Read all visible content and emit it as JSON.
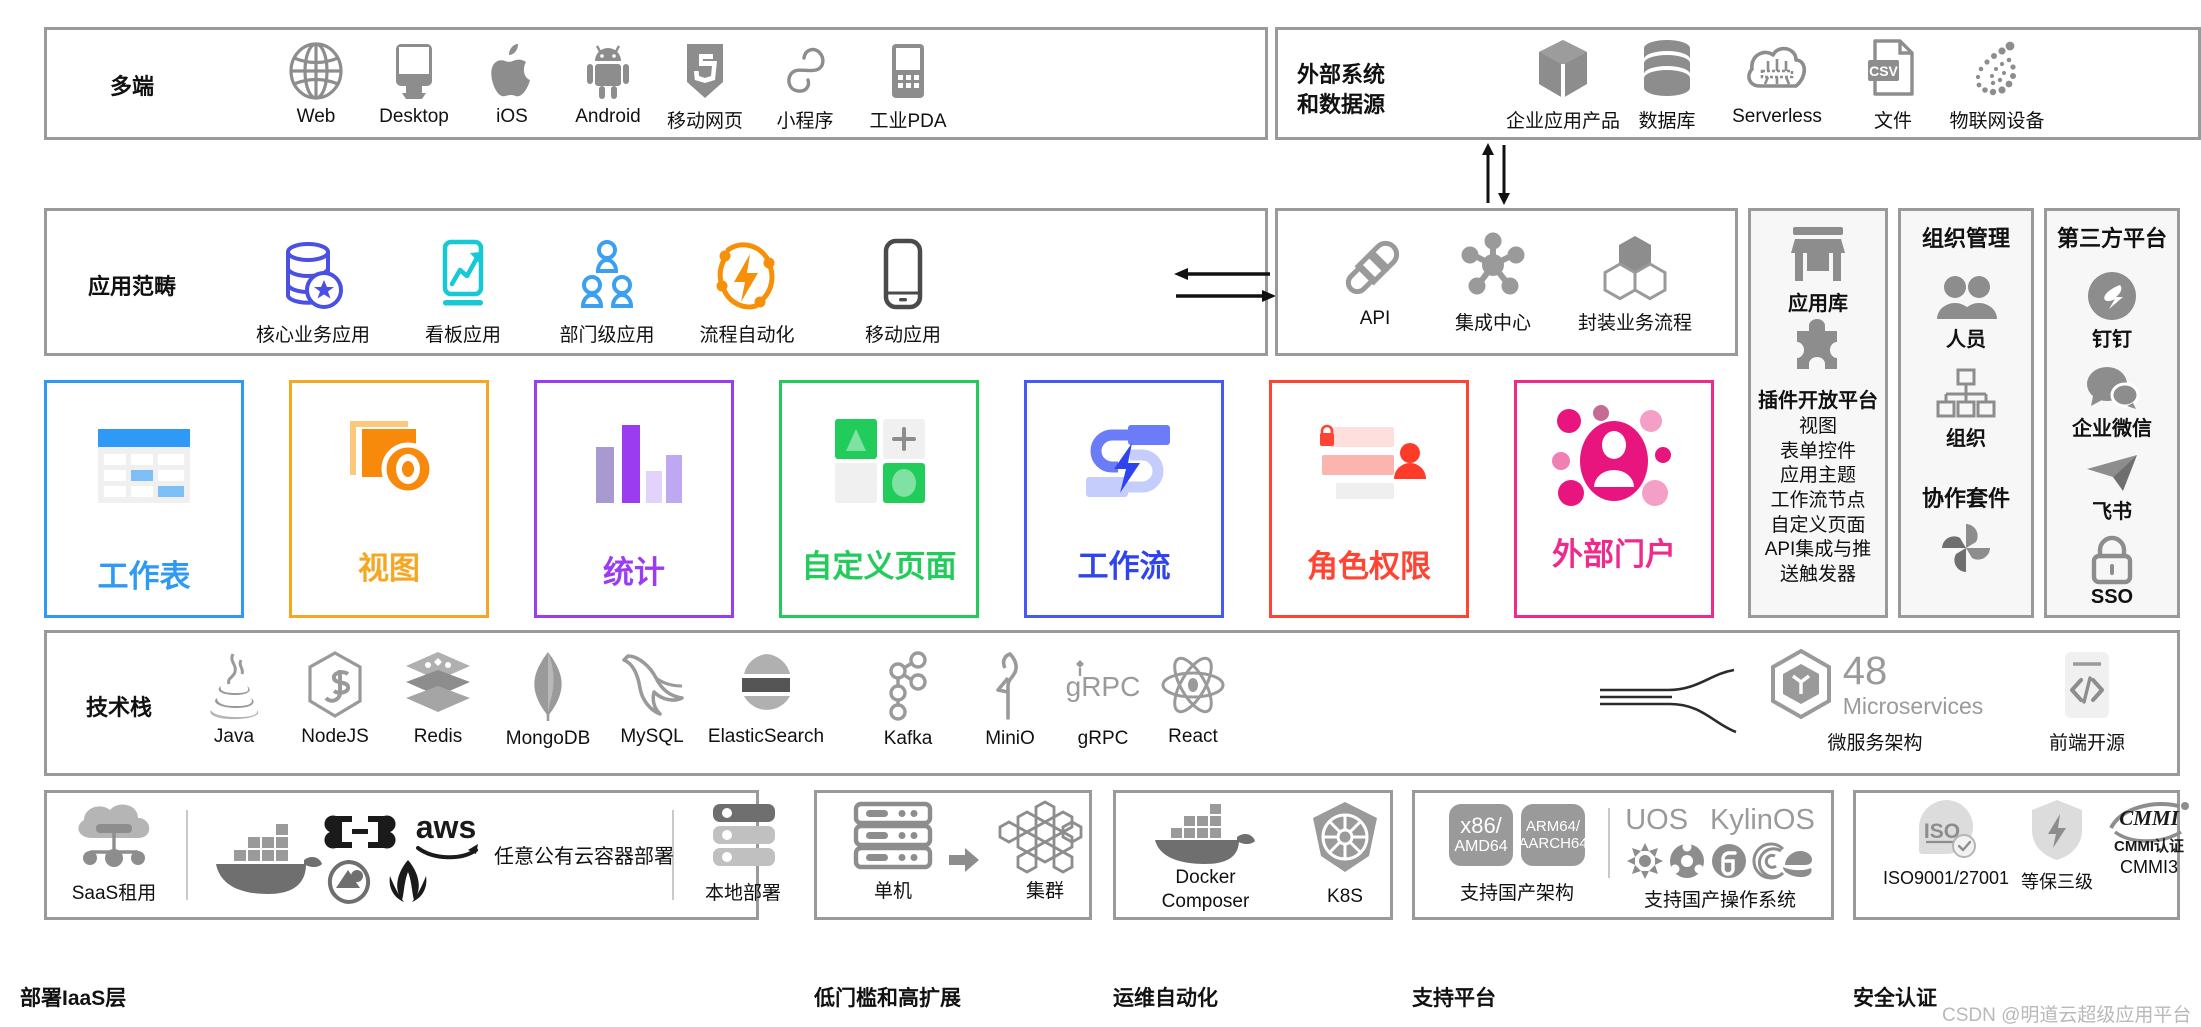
{
  "meta": {
    "watermark": "CSDN @明道云超级应用平台"
  },
  "rows": {
    "multi_client": {
      "label": "多端",
      "items": [
        {
          "caption": "Web",
          "icon": "globe-icon"
        },
        {
          "caption": "Desktop",
          "icon": "desktop-monitor-icon"
        },
        {
          "caption": "iOS",
          "icon": "apple-icon"
        },
        {
          "caption": "Android",
          "icon": "android-icon"
        },
        {
          "caption": "移动网页",
          "icon": "html5-icon"
        },
        {
          "caption": "小程序",
          "icon": "miniprogram-icon"
        },
        {
          "caption": "工业PDA",
          "icon": "industrial-pda-icon"
        }
      ]
    },
    "external": {
      "label": "外部系统\n和数据源",
      "items": [
        {
          "caption": "企业应用产品",
          "icon": "cube-package-icon"
        },
        {
          "caption": "数据库",
          "icon": "database-icon"
        },
        {
          "caption": "Serverless",
          "icon": "serverless-cloud-icon"
        },
        {
          "caption": "文件",
          "icon": "csv-file-icon"
        },
        {
          "caption": "物联网设备",
          "icon": "iot-dots-icon"
        }
      ]
    },
    "app_scope": {
      "label": "应用范畴",
      "items": [
        {
          "caption": "核心业务应用",
          "icon": "core-business-db-icon",
          "color": "#4a50e2"
        },
        {
          "caption": "看板应用",
          "icon": "dashboard-chart-icon",
          "color": "#17c9d4"
        },
        {
          "caption": "部门级应用",
          "icon": "team-users-icon",
          "color": "#3aa0ef"
        },
        {
          "caption": "流程自动化",
          "icon": "automation-bolt-icon",
          "color": "#f79007"
        },
        {
          "caption": "移动应用",
          "icon": "mobile-phone-icon",
          "color": "#4a4a4a"
        }
      ]
    },
    "integration": {
      "items": [
        {
          "caption": "API",
          "icon": "api-plug-icon"
        },
        {
          "caption": "集成中心",
          "icon": "integration-hub-icon"
        },
        {
          "caption": "封装业务流程",
          "icon": "hexagon-process-icon"
        }
      ]
    },
    "tech_stack": {
      "label": "技术栈",
      "items": [
        {
          "caption": "Java",
          "icon": "java-icon"
        },
        {
          "caption": "NodeJS",
          "icon": "nodejs-icon"
        },
        {
          "caption": "Redis",
          "icon": "redis-icon"
        },
        {
          "caption": "MongoDB",
          "icon": "mongodb-icon"
        },
        {
          "caption": "MySQL",
          "icon": "mysql-dolphin-icon"
        },
        {
          "caption": "ElasticSearch",
          "icon": "elasticsearch-icon"
        },
        {
          "caption": "Kafka",
          "icon": "kafka-icon"
        },
        {
          "caption": "MiniO",
          "icon": "minio-icon"
        },
        {
          "caption": "gRPC",
          "icon": "grpc-icon"
        },
        {
          "caption": "React",
          "icon": "react-icon"
        }
      ],
      "microservices": {
        "count": "48",
        "unit": "Microservices",
        "caption": "微服务架构",
        "icon": "microservice-hexagon-icon"
      },
      "frontend": {
        "caption": "前端开源",
        "icon": "code-brackets-icon"
      }
    }
  },
  "feature_cards": [
    {
      "title": "工作表",
      "color": "#2f9af5",
      "icon": "worksheet-table-icon"
    },
    {
      "title": "视图",
      "color": "#f5a623",
      "icon": "view-layers-eye-icon"
    },
    {
      "title": "统计",
      "color": "#9b3cf0",
      "icon": "statistics-bars-icon"
    },
    {
      "title": "自定义页面",
      "color": "#22cc5b",
      "icon": "custom-page-grid-icon"
    },
    {
      "title": "工作流",
      "color": "#4559f5",
      "icon": "workflow-bolt-icon"
    },
    {
      "title": "角色权限",
      "color": "#ff4433",
      "icon": "role-permission-icon"
    },
    {
      "title": "外部门户",
      "color": "#ee2b8d",
      "icon": "external-portal-user-icon"
    }
  ],
  "rails": {
    "app_store": {
      "app_library": {
        "caption": "应用库",
        "icon": "store-shop-icon"
      },
      "plugin_platform": {
        "caption": "插件开放平台",
        "icon": "puzzle-piece-icon",
        "items": [
          "视图",
          "表单控件",
          "应用主题",
          "工作流节点",
          "自定义页面",
          "API集成与推",
          "送触发器"
        ]
      }
    },
    "org_management": {
      "title": "组织管理",
      "items": [
        {
          "caption": "人员",
          "icon": "people-icon"
        },
        {
          "caption": "组织",
          "icon": "org-tree-icon"
        }
      ],
      "collab": {
        "caption": "协作套件",
        "icon": "pinwheel-icon"
      }
    },
    "third_party": {
      "title": "第三方平台",
      "items": [
        {
          "caption": "钉钉",
          "icon": "dingtalk-icon"
        },
        {
          "caption": "企业微信",
          "icon": "wecom-icon"
        },
        {
          "caption": "飞书",
          "icon": "feishu-icon"
        },
        {
          "caption": "SSO",
          "icon": "lock-sso-icon"
        }
      ]
    }
  },
  "bottom": {
    "iaas": {
      "label": "部署IaaS层",
      "saas": {
        "caption": "SaaS租用",
        "icon": "saas-cloud-icon"
      },
      "cloud": {
        "note": "任意公有云容器部署",
        "icons": [
          "docker-whale-icon",
          "alibaba-cloud-icon",
          "aws-icon",
          "tencent-cloud-icon",
          "huawei-cloud-icon"
        ]
      },
      "local": {
        "caption": "本地部署",
        "icon": "server-rack-icon"
      }
    },
    "scalability": {
      "label": "低门槛和高扩展",
      "items": [
        {
          "caption": "单机",
          "icon": "single-server-icon"
        },
        {
          "caption": "集群",
          "icon": "cluster-honeycomb-icon"
        }
      ],
      "arrow": "arrow-right-icon"
    },
    "devops": {
      "label": "运维自动化",
      "items": [
        {
          "caption": "Docker\nComposer",
          "icon": "docker-whale-icon"
        },
        {
          "caption": "K8S",
          "icon": "kubernetes-icon"
        }
      ]
    },
    "platform": {
      "label": "支持平台",
      "arch": {
        "caption": "支持国产架构",
        "chips": [
          {
            "top": "x86/",
            "bottom": "AMD64"
          },
          {
            "top": "ARM64/",
            "bottom": "AARCH64"
          }
        ]
      },
      "os": {
        "caption": "支持国产操作系统",
        "names": [
          "UOS",
          "KylinOS"
        ],
        "icons": [
          "kylin-icon",
          "ubuntu-icon",
          "fedora-icon",
          "debian-icon",
          "redhat-icon"
        ]
      }
    },
    "security": {
      "label": "安全认证",
      "items": [
        {
          "caption": "ISO9001/27001",
          "icon": "iso-badge-icon"
        },
        {
          "caption": "等保三级",
          "icon": "shield-bolt-icon"
        },
        {
          "caption": "CMMI3",
          "icon": "cmmi-icon",
          "sub": "CMMI认证"
        }
      ]
    }
  }
}
